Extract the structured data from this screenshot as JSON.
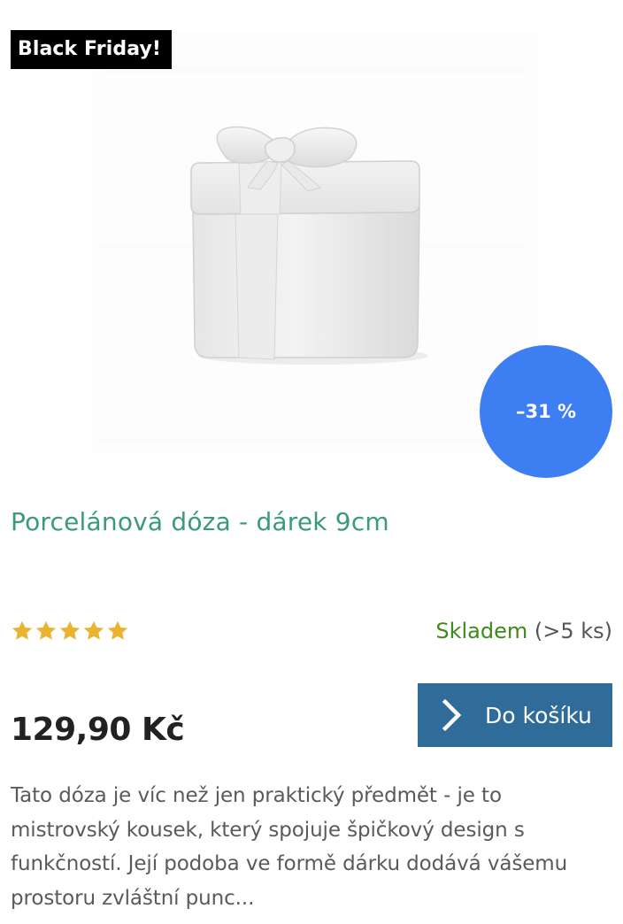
{
  "badge": {
    "label": "Black Friday!"
  },
  "product": {
    "image_alt": "Porcelánová dóza - dárek 9cm",
    "discount": "–31 %",
    "title": "Porcelánová dóza - dárek 9cm",
    "rating": {
      "stars": 5,
      "max": 5
    },
    "stock": {
      "status": "Skladem",
      "detail": "(>5 ks)"
    },
    "price": "129,90 Kč",
    "cart_button_label": "Do košíku",
    "description": "Tato dóza je víc než jen praktický předmět - je to mistrovský kousek, který spojuje špičkový design s funkčností. Její podoba ve formě dárku dodává vášemu prostoru zvláštní punc..."
  },
  "colors": {
    "badge_bg": "#000000",
    "discount_bg": "#3d7ff2",
    "title": "#3a9b7a",
    "stock_ok": "#3d8b19",
    "button_bg": "#2f6c9a",
    "star": "#e9b530"
  },
  "icons": {
    "star": "star-icon",
    "chevron": "chevron-right-icon"
  }
}
